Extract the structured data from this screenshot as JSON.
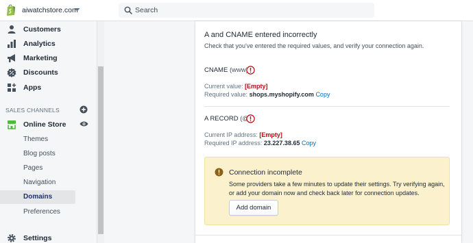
{
  "topbar": {
    "store_name": "aiwatchstore.com",
    "search_placeholder": "Search"
  },
  "sidebar": {
    "items": [
      {
        "label": "Customers",
        "icon": "person-icon"
      },
      {
        "label": "Analytics",
        "icon": "bar-chart-icon"
      },
      {
        "label": "Marketing",
        "icon": "megaphone-icon"
      },
      {
        "label": "Discounts",
        "icon": "discount-icon"
      },
      {
        "label": "Apps",
        "icon": "apps-icon"
      }
    ],
    "sales_channels_heading": "SALES CHANNELS",
    "online_store": {
      "label": "Online Store",
      "icon": "store-icon"
    },
    "sub_items": [
      "Themes",
      "Blog posts",
      "Pages",
      "Navigation",
      "Domains",
      "Preferences"
    ],
    "active_sub_item": "Domains",
    "settings": {
      "label": "Settings",
      "icon": "gear-icon"
    }
  },
  "card": {
    "title": "A and CNAME entered incorrectly",
    "subtitle": "Check that you've entered the required values, and verify your connection again.",
    "cname": {
      "title": "CNAME",
      "host": "(www)",
      "current_label": "Current value:",
      "current_value": "[Empty]",
      "required_label": "Required value:",
      "required_value": "shops.myshopify.com",
      "copy": "Copy"
    },
    "a_record": {
      "title": "A RECORD",
      "host": "(@)",
      "current_label": "Current IP address:",
      "current_value": "[Empty]",
      "required_label": "Required IP address:",
      "required_value": "23.227.38.65",
      "copy": "Copy"
    }
  },
  "banner": {
    "title": "Connection incomplete",
    "body": "Some providers take a few minutes to update their settings. Try verifying again, or add your domain now and check back later for connection updates.",
    "button": "Add domain"
  },
  "colors": {
    "accent": "#202e78",
    "error": "#bf0711",
    "link": "#006fbb",
    "warning_bg": "#fcf1cd",
    "warning_icon": "#8a6116",
    "brand": "#95bf47"
  }
}
